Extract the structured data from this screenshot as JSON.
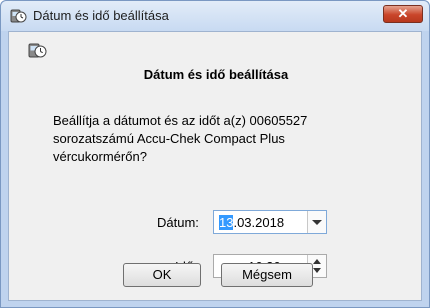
{
  "window": {
    "title": "Dátum és idő beállítása",
    "close_label": "✕"
  },
  "dialog": {
    "heading": "Dátum és idő beállítása",
    "message_lines": [
      "Beállítja a dátumot és az időt a(z) 00605527",
      "sorozatszámú Accu-Chek Compact Plus",
      "vércukormérőn?"
    ],
    "date_label": "Dátum:",
    "date_selected_part": "13",
    "date_rest": ".03.2018",
    "time_label": "Idő:",
    "time_value": "16:26",
    "ok_label": "OK",
    "cancel_label": "Mégsem"
  },
  "colors": {
    "accent": "#3399ff",
    "close": "#c9452a",
    "window_border": "#7a98c2"
  }
}
